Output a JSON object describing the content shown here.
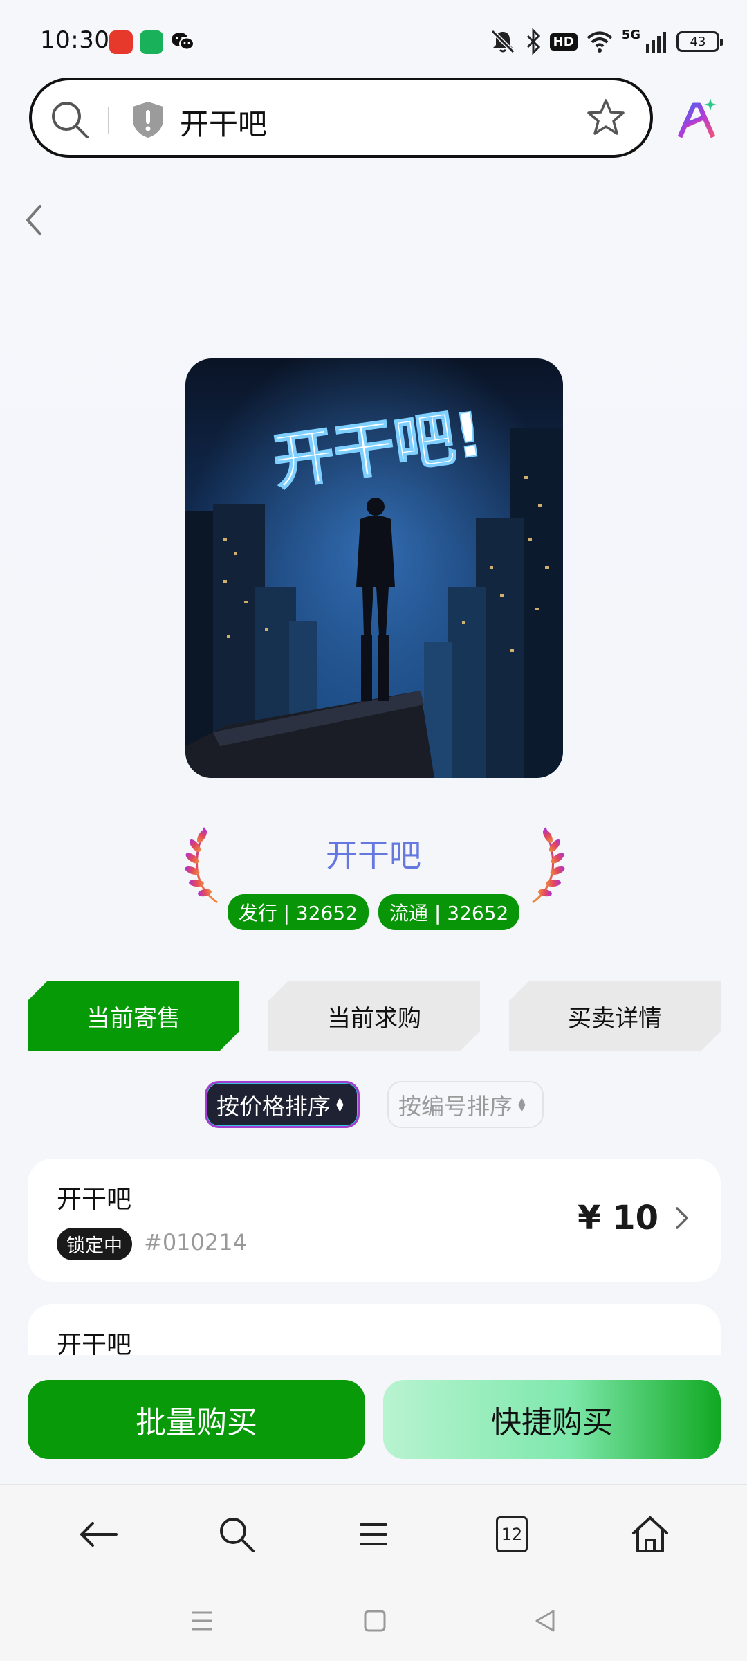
{
  "status": {
    "time": "10:30",
    "hd": "HD",
    "network": "5G",
    "battery": "43"
  },
  "search": {
    "query": "开干吧"
  },
  "hero": {
    "artwork_text": "开干吧!"
  },
  "nft": {
    "title": "开干吧",
    "issued": "发行 | 32652",
    "circulating": "流通 | 32652"
  },
  "tabs": [
    {
      "label": "当前寄售"
    },
    {
      "label": "当前求购"
    },
    {
      "label": "买卖详情"
    }
  ],
  "sort": {
    "price": "按价格排序",
    "number": "按编号排序"
  },
  "listings": [
    {
      "name": "开干吧",
      "status": "锁定中",
      "serial": "#010214",
      "price": "¥ 10"
    },
    {
      "name": "开干吧"
    }
  ],
  "actions": {
    "bulk_buy": "批量购买",
    "quick_buy": "快捷购买"
  },
  "browser_nav": {
    "tab_count": "12"
  },
  "colors": {
    "accent_green": "#089a08",
    "title_blue": "#6478e0"
  }
}
